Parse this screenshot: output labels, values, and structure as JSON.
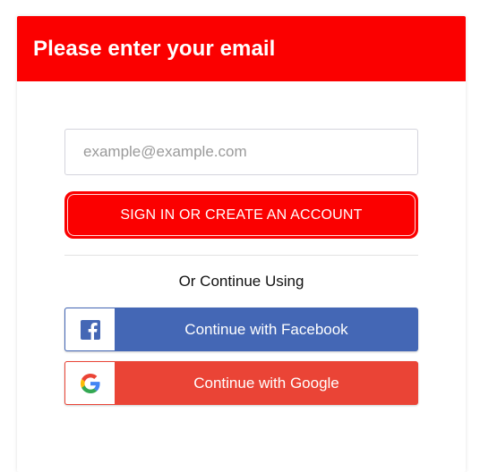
{
  "header": {
    "title": "Please enter your email"
  },
  "email": {
    "placeholder": "example@example.com",
    "value": ""
  },
  "signin": {
    "label": "SIGN IN OR CREATE AN ACCOUNT"
  },
  "divider_text": "Or Continue Using",
  "social": {
    "facebook": {
      "label": "Continue with Facebook",
      "icon": "facebook-icon",
      "color": "#4467b5"
    },
    "google": {
      "label": "Continue with Google",
      "icon": "google-icon",
      "color": "#ea4436"
    }
  },
  "colors": {
    "accent": "#fb0000"
  }
}
